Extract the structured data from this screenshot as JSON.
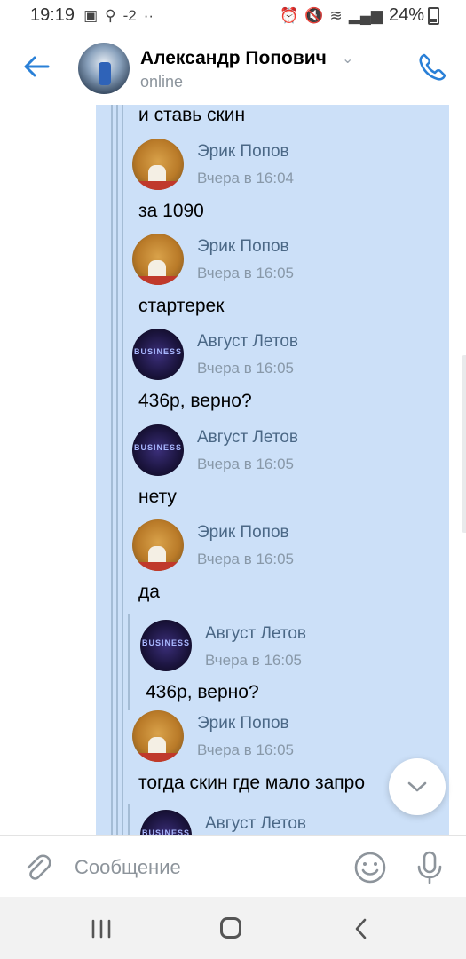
{
  "status_bar": {
    "time": "19:19",
    "temperature": "-2",
    "dots": "··",
    "battery": "24%"
  },
  "header": {
    "title": "Александр Попович",
    "status": "online"
  },
  "chat": {
    "top_text": "и ставь скин",
    "messages": [
      {
        "author": "Эрик Попов",
        "time": "Вчера в 16:04",
        "text": "за 1090"
      },
      {
        "author": "Эрик Попов",
        "time": "Вчера в 16:05",
        "text": "стартерек"
      },
      {
        "author": "Август Летов",
        "time": "Вчера в 16:05",
        "text": "436р, верно?"
      },
      {
        "author": "Август Летов",
        "time": "Вчера в 16:05",
        "text": "нету"
      },
      {
        "author": "Эрик Попов",
        "time": "Вчера в 16:05",
        "text": "да"
      }
    ],
    "nested_quote": {
      "author": "Август Летов",
      "time": "Вчера в 16:05",
      "text": "436р, верно?"
    },
    "after": {
      "author": "Эрик Попов",
      "time": "Вчера в 16:05",
      "text": "тогда скин где мало запро"
    },
    "nested_quote_2": {
      "author": "Август Летов"
    },
    "avatar_text": "BUSINESS"
  },
  "compose": {
    "placeholder": "Сообщение"
  },
  "colors": {
    "accent": "#2a80d7",
    "selection": "#cce0f8",
    "author": "#4b6886"
  }
}
